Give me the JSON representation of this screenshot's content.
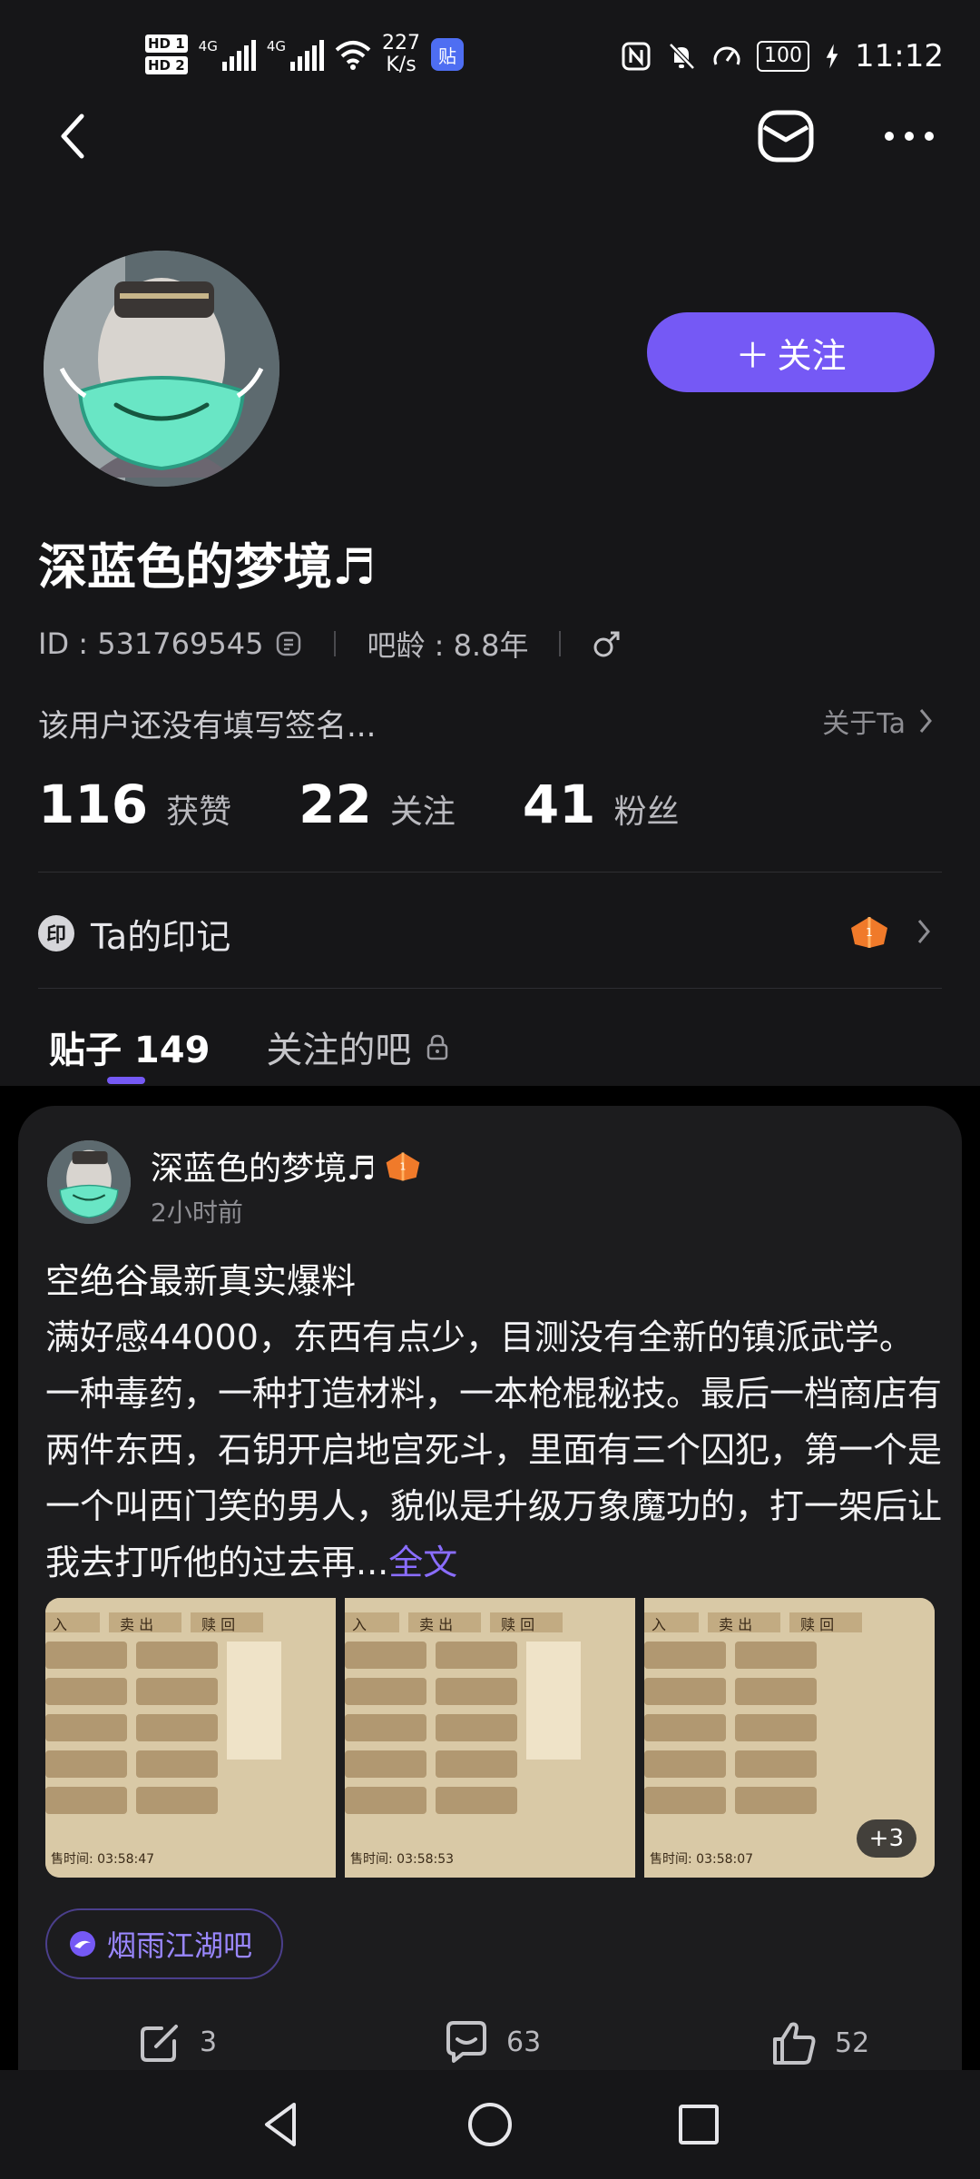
{
  "status_bar": {
    "hd1": "HD 1",
    "hd2": "HD 2",
    "sig1_label": "4G",
    "sig2_label": "4G",
    "speed_value": "227",
    "speed_unit": "K/s",
    "app_badge": "贴",
    "nfc_icon": "nfc-icon",
    "mute_icon": "bell-mute-icon",
    "battery": "100",
    "time": "11:12"
  },
  "profile": {
    "username": "深蓝色的梦境♬",
    "id_text": "ID : 531769545",
    "bar_age": "吧龄 : 8.8年",
    "signature": "该用户还没有填写签名...",
    "about_label": "关于Ta",
    "follow_label": "关注",
    "stats": [
      {
        "num": "116",
        "label": "获赞"
      },
      {
        "num": "22",
        "label": "关注"
      },
      {
        "num": "41",
        "label": "粉丝"
      }
    ],
    "imprint_icon_text": "印",
    "imprint_label": "Ta的印记"
  },
  "tabs": [
    {
      "label": "贴子 149",
      "active": true
    },
    {
      "label": "关注的吧",
      "active": false
    }
  ],
  "post": {
    "author": "深蓝色的梦境♬",
    "time": "2小时前",
    "title": "空绝谷最新真实爆料",
    "body": "满好感44000，东西有点少，目测没有全新的镇派武学。一种毒药，一种打造材料，一本枪棍秘技。最后一档商店有两件东西，石钥开启地宫死斗，里面有三个囚犯，第一个是一个叫西门笑的男人，貌似是升级万象魔功的，打一架后让我去打听他的过去再...",
    "read_more": "全文",
    "images": [
      {
        "timestamp": "售时间: 03:58:47",
        "tabs": [
          "入",
          "卖 出",
          "赎 回"
        ]
      },
      {
        "timestamp": "售时间: 03:58:53",
        "tabs": [
          "入",
          "卖 出",
          "赎 回"
        ]
      },
      {
        "timestamp": "售时间: 03:58:07",
        "tabs": [
          "入",
          "卖 出",
          "赎 回"
        ]
      }
    ],
    "more_images": "+3",
    "forum": "烟雨江湖吧",
    "share_count": "3",
    "comment_count": "63",
    "like_count": "52"
  },
  "colors": {
    "accent": "#7559f5",
    "background": "#161618",
    "card": "#1c1c1e",
    "link": "#8a6dff"
  }
}
